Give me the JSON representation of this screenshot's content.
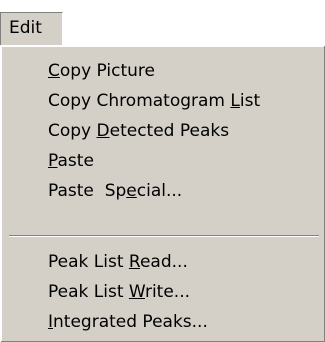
{
  "menubar": {
    "edit_label": "Edit"
  },
  "menu": {
    "items": [
      {
        "pre": "",
        "acc": "C",
        "post": "opy Picture"
      },
      {
        "pre": "Copy Chromatogram ",
        "acc": "L",
        "post": "ist"
      },
      {
        "pre": "Copy ",
        "acc": "D",
        "post": "etected Peaks"
      },
      {
        "pre": "",
        "acc": "P",
        "post": "aste"
      },
      {
        "pre": "Paste  Sp",
        "acc": "e",
        "post": "cial..."
      },
      {
        "pre": "Peak List ",
        "acc": "R",
        "post": "ead..."
      },
      {
        "pre": "Peak List ",
        "acc": "W",
        "post": "rite..."
      },
      {
        "pre": "",
        "acc": "I",
        "post": "ntegrated Peaks..."
      }
    ]
  }
}
